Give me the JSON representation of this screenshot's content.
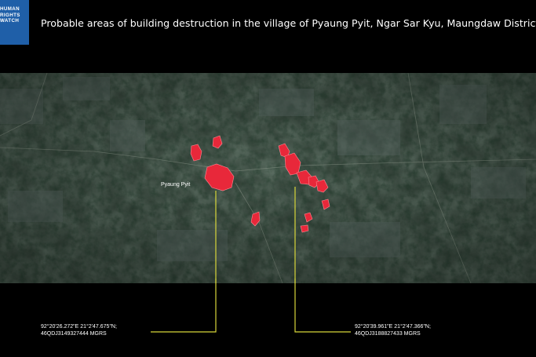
{
  "org_logo": {
    "lines": [
      "HUMAN",
      "RIGHTS",
      "WATCH"
    ],
    "color": "#1f5fa8"
  },
  "title": "Probable areas of building destruction in the village of Pyaung Pyit, Ngar Sar Kyu, Maungdaw District.",
  "map": {
    "place_label": "Pyaung Pyit",
    "destruction_color": "#e8283a",
    "leader_color": "#d8d63a"
  },
  "coordinates": [
    {
      "line1": "92°20'26.272\"E  21°2'47.675\"N;",
      "line2": "46QDJ3149327444 MGRS"
    },
    {
      "line1": "92°20'39.961\"E  21°2'47.366\"N;",
      "line2": "46QDJ3188827433 MGRS"
    }
  ]
}
